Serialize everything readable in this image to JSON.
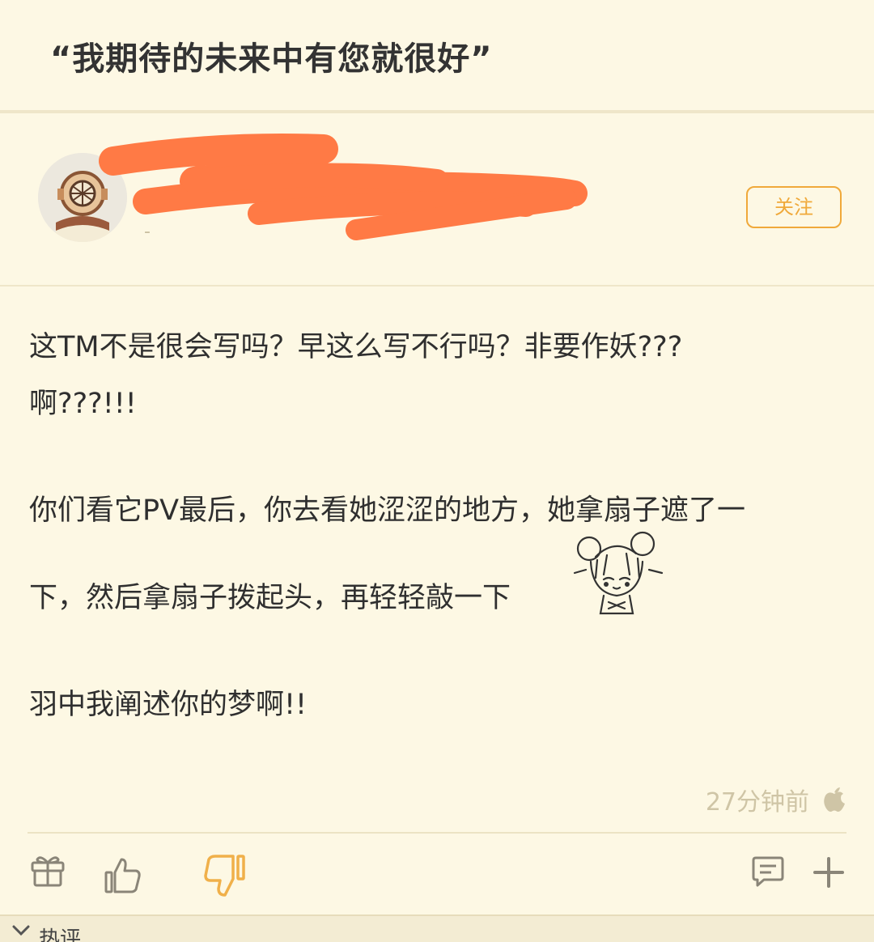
{
  "post": {
    "title": "“我期待的未来中有您就很好”",
    "body": {
      "line1": "这TM不是很会写吗？早这么写不行吗？非要作妖???",
      "line2": "啊???!!!",
      "line3": "你们看它PV最后，你去看她涩涩的地方，她拿扇子遮了一",
      "line4": "下，然后拿扇子拨起头，再轻轻敲一下",
      "line5": "羽中我阐述你的梦啊!!"
    },
    "timestamp": "27分钟前"
  },
  "author": {
    "name": "",
    "meta": "",
    "sub": "-",
    "follow_label": "关注"
  },
  "icons": {
    "gift": "gift-icon",
    "like": "thumbs-up-icon",
    "dislike": "thumbs-down-icon",
    "comment": "comment-icon",
    "more": "plus-icon",
    "platform": "apple-icon",
    "collapse": "chevron-down-icon"
  },
  "hot_comments": {
    "label": "热评"
  },
  "colors": {
    "background": "#fdf8e4",
    "accent": "#f0a93a",
    "redaction": "#ff7a45"
  }
}
